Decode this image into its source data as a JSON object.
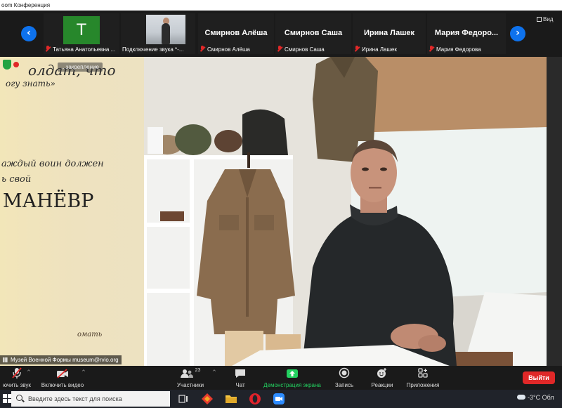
{
  "window": {
    "title": "oom Конференция"
  },
  "gallery": {
    "view_label": "Вид",
    "tiles": [
      {
        "footer_name": "Татьяна Анатольевна ...",
        "avatar_letter": "T"
      },
      {
        "footer_name": "Подключение звука *-..."
      },
      {
        "big_name": "Смирнов Алёша",
        "footer_name": "Смирнов Алёша"
      },
      {
        "big_name": "Смирнов Саша",
        "footer_name": "Смирнов Саша"
      },
      {
        "big_name": "Ирина Лашек",
        "footer_name": "Ирина Лашек"
      },
      {
        "big_name": "Мария Федоро...",
        "footer_name": "Мария Федорова"
      }
    ]
  },
  "main_video": {
    "pin_label": "...закрепление",
    "participant_label": "Музей Военной Формы museum@rvio.org",
    "wall_text_top_1": "олдат, что",
    "wall_text_top_2": "огу знать»",
    "wall_text_mid_1": "аждый воин должен",
    "wall_text_mid_2": "ь свой",
    "wall_text_big": "МАНЁВР",
    "wall_text_bottom": "омать"
  },
  "toolbar": {
    "mute_label": "ючить звук",
    "video_label": "Включить видео",
    "participants_label": "Участники",
    "participants_count": "23",
    "chat_label": "Чат",
    "share_label": "Демонстрация экрана",
    "record_label": "Запись",
    "reactions_label": "Реакции",
    "apps_label": "Приложения",
    "leave_label": "Выйти"
  },
  "taskbar": {
    "search_placeholder": "Введите здесь текст для поиска",
    "weather": "-3°C Обл"
  },
  "colors": {
    "accent": "#0e72ed",
    "leave": "#e02828",
    "share_green": "#23d160"
  }
}
